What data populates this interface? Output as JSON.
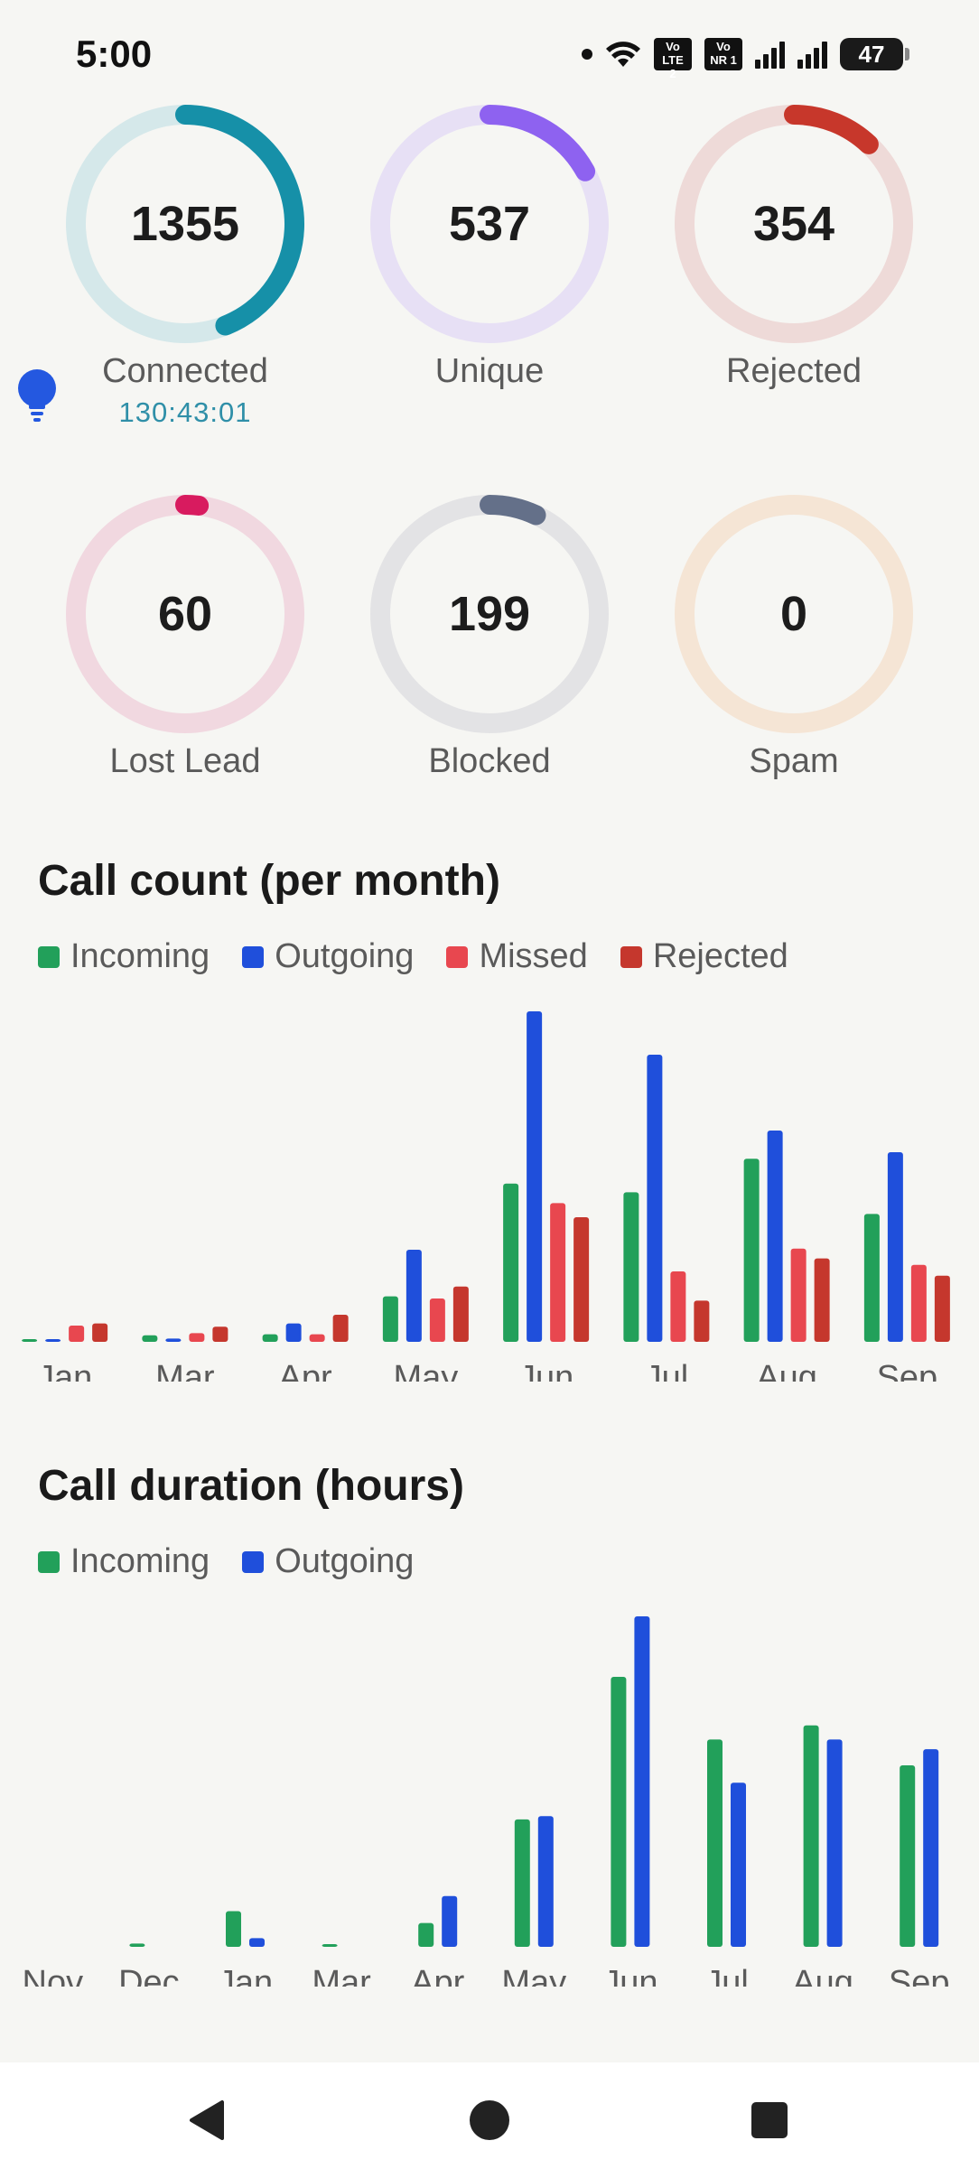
{
  "status_bar": {
    "time": "5:00",
    "sim1_badge": "Vo LTE 2",
    "sim2_badge": "Vo NR 1",
    "battery": "47"
  },
  "stats": [
    {
      "value": "1355",
      "label": "Connected",
      "sub": "130:43:01",
      "fraction": 0.44,
      "color": "#1690a8",
      "track": "#d5e8ea"
    },
    {
      "value": "537",
      "label": "Unique",
      "sub": "",
      "fraction": 0.17,
      "color": "#8e62f0",
      "track": "#e7e0f5"
    },
    {
      "value": "354",
      "label": "Rejected",
      "sub": "",
      "fraction": 0.12,
      "color": "#c7372b",
      "track": "#eedad8"
    },
    {
      "value": "60",
      "label": "Lost Lead",
      "sub": "",
      "fraction": 0.02,
      "color": "#d81b5f",
      "track": "#f1d8e0"
    },
    {
      "value": "199",
      "label": "Blocked",
      "sub": "",
      "fraction": 0.07,
      "color": "#647089",
      "track": "#e3e3e5"
    },
    {
      "value": "0",
      "label": "Spam",
      "sub": "",
      "fraction": 0.0,
      "color": "#e6a05a",
      "track": "#f5e5d5"
    }
  ],
  "chart_data": [
    {
      "type": "bar",
      "title": "Call count (per month)",
      "categories": [
        "Jan",
        "Mar",
        "Apr",
        "May",
        "Jun",
        "Jul",
        "Aug",
        "Sep"
      ],
      "series": [
        {
          "name": "Incoming",
          "color": "#22a05a",
          "values": [
            2,
            6,
            7,
            42,
            146,
            138,
            169,
            118
          ]
        },
        {
          "name": "Outgoing",
          "color": "#1f4fdb",
          "values": [
            2,
            3,
            17,
            85,
            305,
            265,
            195,
            175
          ]
        },
        {
          "name": "Missed",
          "color": "#e8474f",
          "values": [
            15,
            8,
            7,
            40,
            128,
            65,
            86,
            71
          ]
        },
        {
          "name": "Rejected",
          "color": "#c5372d",
          "values": [
            17,
            14,
            25,
            51,
            115,
            38,
            77,
            61
          ]
        }
      ],
      "legend": "top-left",
      "grid": false
    },
    {
      "type": "bar",
      "title": "Call duration (hours)",
      "categories": [
        "Nov",
        "Dec",
        "Jan",
        "Mar",
        "Apr",
        "May",
        "Jun",
        "Jul",
        "Aug",
        "Sep"
      ],
      "series": [
        {
          "name": "Incoming",
          "color": "#22a05a",
          "values": [
            0,
            0.3,
            3.3,
            0.2,
            2.2,
            11.8,
            25,
            19.2,
            20.5,
            16.8
          ]
        },
        {
          "name": "Outgoing",
          "color": "#1f4fdb",
          "values": [
            0,
            0,
            0.8,
            0,
            4.7,
            12.1,
            30.6,
            15.2,
            19.2,
            18.3
          ]
        }
      ],
      "legend": "top-left",
      "grid": false
    }
  ]
}
